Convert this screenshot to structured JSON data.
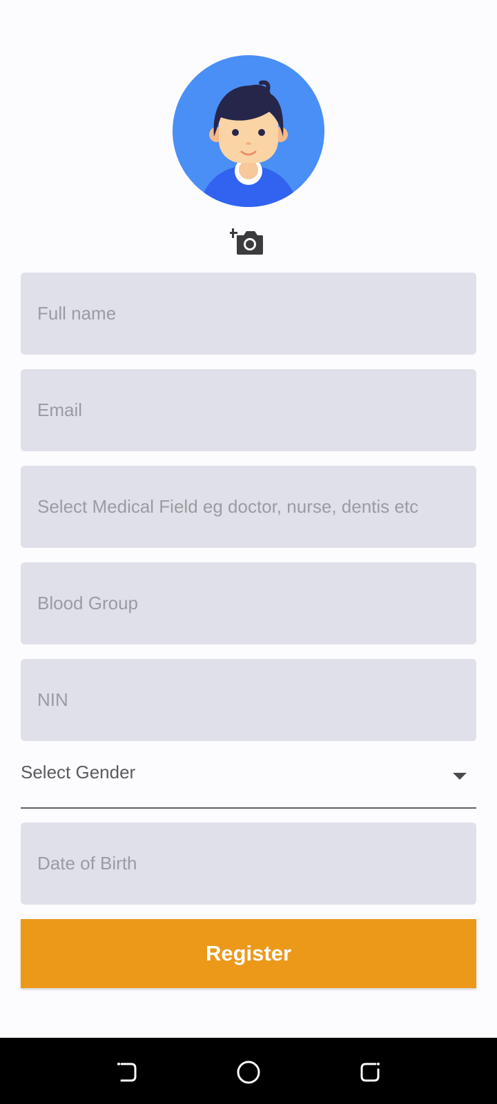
{
  "app": {
    "accent_color": "#ec991a",
    "field_bg_color": "#dfe0e9",
    "avatar_bg_color": "#4a8ff5"
  },
  "avatar": {
    "icon": "user-avatar-icon"
  },
  "add_photo": {
    "icon": "add-photo-camera-icon"
  },
  "form": {
    "full_name": {
      "placeholder": "Full name",
      "value": ""
    },
    "email": {
      "placeholder": "Email",
      "value": ""
    },
    "medical_field": {
      "placeholder": "Select Medical Field eg doctor, nurse, dentis etc",
      "value": ""
    },
    "blood_group": {
      "placeholder": "Blood Group",
      "value": ""
    },
    "nin": {
      "placeholder": "NIN",
      "value": ""
    },
    "gender": {
      "label": "Select Gender",
      "icon": "dropdown-arrow-icon"
    },
    "date_of_birth": {
      "placeholder": "Date of Birth",
      "value": ""
    }
  },
  "register_button": {
    "label": "Register"
  },
  "nav_bar": {
    "back_icon": "back-icon",
    "home_icon": "home-icon",
    "recents_icon": "recents-icon"
  }
}
